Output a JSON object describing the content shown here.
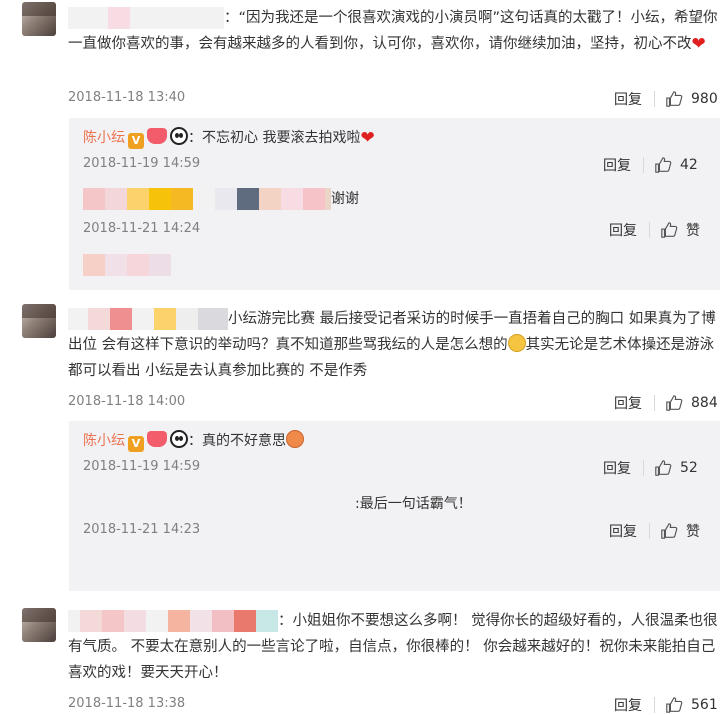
{
  "comments": [
    {
      "text": "：“因为我还是一个很喜欢演戏的小演员啊”这句话真的太戳了！小纭，希望你一直做你喜欢的事，会有越来越多的人看到你，认可你，喜欢你，请你继续加油，坚持，初心不改",
      "emoji": "heart",
      "time": "2018-11-18 13:40",
      "reply_label": "回复",
      "likes": "980",
      "replies": [
        {
          "name": "陈小纭",
          "text": "：不忘初心 我要滚去拍戏啦",
          "emoji": "heart",
          "time": "2018-11-19 14:59",
          "reply_label": "回复",
          "likes": "42"
        },
        {
          "name": "",
          "text": "谢谢",
          "time": "2018-11-21 14:24",
          "reply_label": "回复",
          "likes": "赞"
        }
      ]
    },
    {
      "text": "小纭游完比赛 最后接受记者采访的时候手一直捂着自己的胸口 如果真为了博出位 会有这样下意识的举动吗？真不知道那些骂我纭的人是怎么想的",
      "text_after_emoji": "其实无论是艺术体操还是游泳 都可以看出 小纭是去认真参加比赛的 不是作秀",
      "time": "2018-11-18 14:00",
      "reply_label": "回复",
      "likes": "884",
      "replies": [
        {
          "name": "陈小纭",
          "text": "：真的不好意思",
          "time": "2018-11-19 14:59",
          "reply_label": "回复",
          "likes": "52"
        },
        {
          "name": "",
          "text": ":最后一句话霸气！",
          "time": "2018-11-21 14:23",
          "reply_label": "回复",
          "likes": "赞"
        }
      ]
    },
    {
      "text": "：小姐姐你不要想这么多啊！ 觉得你长的超级好看的，人很温柔也很有气质。 不要太在意别人的一些言论了啦，自信点，你很棒的！ 你会越来越好的！祝你未来能拍自己喜欢的戏！要天天开心！",
      "time": "2018-11-18 13:38",
      "reply_label": "回复",
      "likes": "561"
    }
  ],
  "colors": {
    "name": "#eb7350",
    "meta": "#808080",
    "reply_bg": "#f2f2f5"
  }
}
